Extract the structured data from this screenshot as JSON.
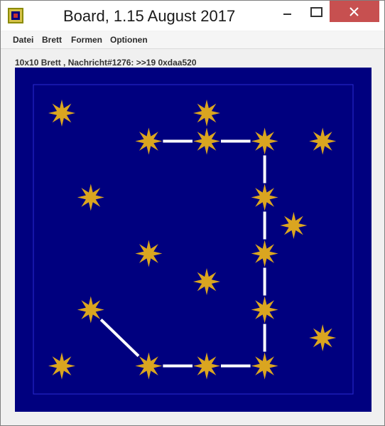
{
  "window": {
    "title": "Board, 1.15 August 2017",
    "close_color": "#c75050"
  },
  "icons": {
    "app": "app-icon",
    "minimize": "minimize-icon",
    "maximize": "maximize-icon",
    "close": "close-icon"
  },
  "menu": {
    "items": [
      "Datei",
      "Brett",
      "Formen",
      "Optionen"
    ]
  },
  "status": {
    "text": "10x10 Brett , Nachricht#1276: >>19 0xdaa520"
  },
  "board": {
    "rows": 10,
    "cols": 10,
    "background_color": "#00007f",
    "star_color": "#daa520",
    "line_color": "#ffffff",
    "stars": [
      {
        "col": 0,
        "row": 0
      },
      {
        "col": 5,
        "row": 0
      },
      {
        "col": 3,
        "row": 1
      },
      {
        "col": 5,
        "row": 1
      },
      {
        "col": 7,
        "row": 1
      },
      {
        "col": 9,
        "row": 1
      },
      {
        "col": 1,
        "row": 3
      },
      {
        "col": 7,
        "row": 3
      },
      {
        "col": 8,
        "row": 4
      },
      {
        "col": 3,
        "row": 5
      },
      {
        "col": 7,
        "row": 5
      },
      {
        "col": 5,
        "row": 6
      },
      {
        "col": 1,
        "row": 7
      },
      {
        "col": 7,
        "row": 7
      },
      {
        "col": 9,
        "row": 8
      },
      {
        "col": 0,
        "row": 9
      },
      {
        "col": 3,
        "row": 9
      },
      {
        "col": 5,
        "row": 9
      },
      {
        "col": 7,
        "row": 9
      }
    ],
    "path": [
      {
        "col": 3,
        "row": 1
      },
      {
        "col": 5,
        "row": 1
      },
      {
        "col": 7,
        "row": 1
      },
      {
        "col": 7,
        "row": 3
      },
      {
        "col": 7,
        "row": 5
      },
      {
        "col": 7,
        "row": 7
      },
      {
        "col": 7,
        "row": 9
      },
      {
        "col": 5,
        "row": 9
      },
      {
        "col": 3,
        "row": 9
      },
      {
        "col": 1,
        "row": 7
      }
    ]
  }
}
